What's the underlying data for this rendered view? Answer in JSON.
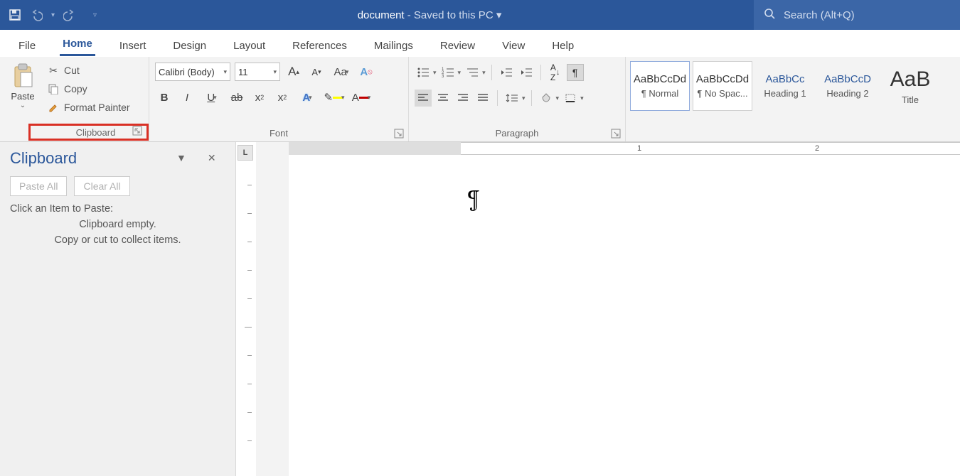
{
  "titlebar": {
    "doc_name": "document",
    "save_status": "Saved to this PC",
    "search_placeholder": "Search (Alt+Q)"
  },
  "tabs": [
    "File",
    "Home",
    "Insert",
    "Design",
    "Layout",
    "References",
    "Mailings",
    "Review",
    "View",
    "Help"
  ],
  "active_tab": "Home",
  "clipboard_group": {
    "paste": "Paste",
    "cut": "Cut",
    "copy": "Copy",
    "format_painter": "Format Painter",
    "label": "Clipboard"
  },
  "font_group": {
    "font_name": "Calibri (Body)",
    "font_size": "11",
    "label": "Font"
  },
  "paragraph_group": {
    "label": "Paragraph"
  },
  "styles": [
    {
      "sample": "AaBbCcDd",
      "name": "¶ Normal",
      "kind": "sel"
    },
    {
      "sample": "AaBbCcDd",
      "name": "¶ No Spac...",
      "kind": "hov"
    },
    {
      "sample": "AaBbCc",
      "name": "Heading 1",
      "kind": "hd"
    },
    {
      "sample": "AaBbCcD",
      "name": "Heading 2",
      "kind": "hd"
    },
    {
      "sample": "AaB",
      "name": "Title",
      "kind": "big"
    }
  ],
  "sidepane": {
    "title": "Clipboard",
    "paste_all": "Paste All",
    "clear_all": "Clear All",
    "hint": "Click an Item to Paste:",
    "empty1": "Clipboard empty.",
    "empty2": "Copy or cut to collect items."
  },
  "ruler": {
    "n1": "1",
    "n2": "2"
  },
  "document": {
    "paragraph_mark": "¶"
  }
}
